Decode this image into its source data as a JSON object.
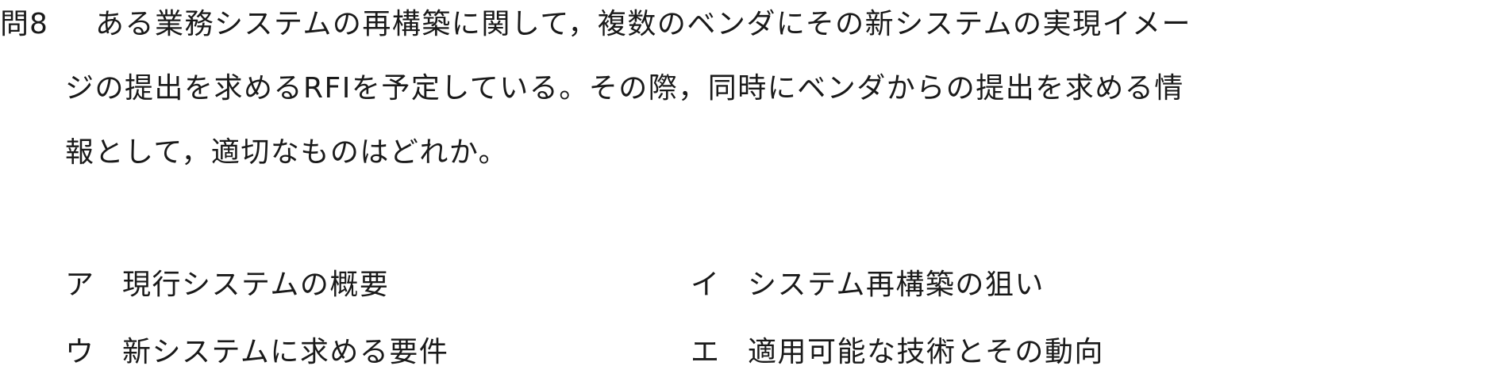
{
  "question": {
    "label": "問8",
    "lines": [
      "ある業務システムの再構築に関して，複数のベンダにその新システムの実現イメー",
      "ジの提出を求めるRFIを予定している。その際，同時にベンダからの提出を求める情",
      "報として，適切なものはどれか。"
    ]
  },
  "choices": [
    {
      "mark": "ア",
      "text": "現行システムの概要"
    },
    {
      "mark": "イ",
      "text": "システム再構築の狙い"
    },
    {
      "mark": "ウ",
      "text": "新システムに求める要件"
    },
    {
      "mark": "エ",
      "text": "適用可能な技術とその動向"
    }
  ]
}
